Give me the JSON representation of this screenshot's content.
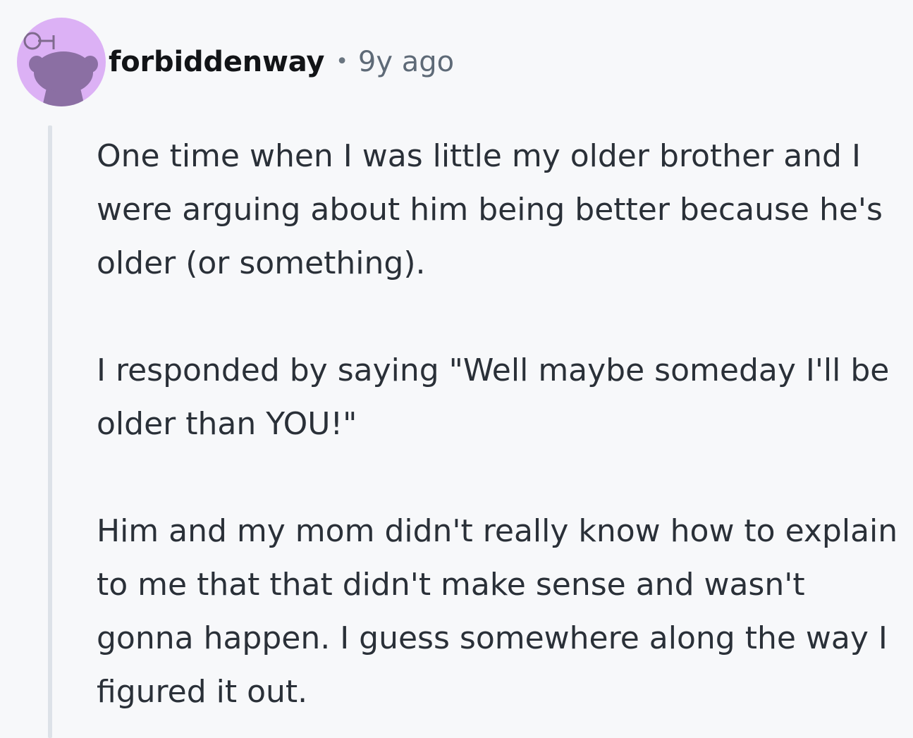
{
  "comment": {
    "avatar_icon": "reddit-snoo-avatar-icon",
    "avatar_color": "#dcb1f5",
    "username": "forbiddenway",
    "separator": "•",
    "timestamp": "9y ago",
    "paragraphs": [
      "One time when I was little my older brother and I were arguing about him being better because he's older (or something).",
      "I responded by saying \"Well maybe someday I'll be older than YOU!\"",
      "Him and my mom didn't really know how to explain to me that that didn't make sense and wasn't gonna happen. I guess somewhere along the way I figured it out."
    ]
  }
}
